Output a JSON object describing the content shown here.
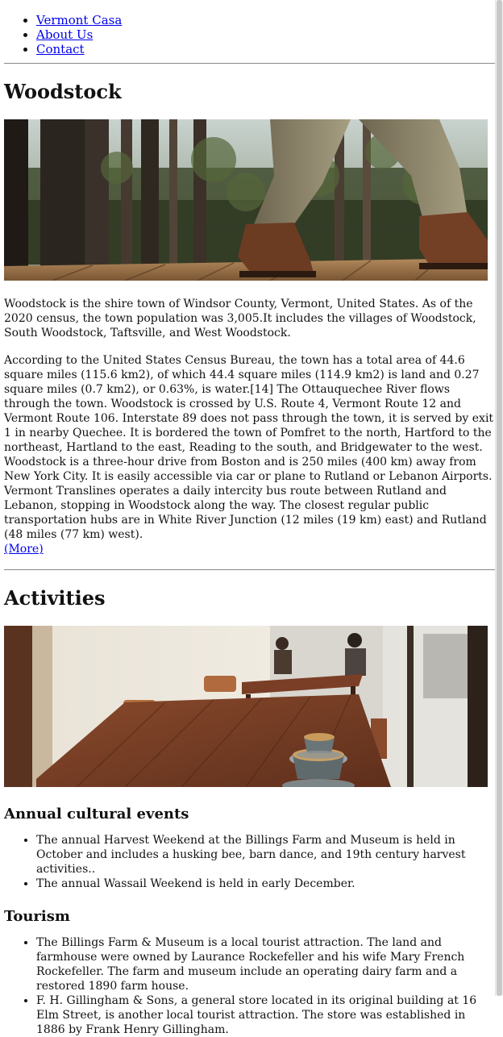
{
  "nav": {
    "items": [
      {
        "label": "Vermont Casa"
      },
      {
        "label": "About Us"
      },
      {
        "label": "Contact"
      }
    ]
  },
  "woodstock": {
    "heading": "Woodstock",
    "intro": "Woodstock is the shire town of Windsor County, Vermont, United States. As of the 2020 census, the town population was 3,005.It includes the villages of Woodstock, South Woodstock, Taftsville, and West Woodstock.",
    "geography": "According to the United States Census Bureau, the town has a total area of 44.6 square miles (115.6 km2), of which 44.4 square miles (114.9 km2) is land and 0.27 square miles (0.7 km2), or 0.63%, is water.[14] The Ottauquechee River flows through the town. Woodstock is crossed by U.S. Route 4, Vermont Route 12 and Vermont Route 106. Interstate 89 does not pass through the town, it is served by exit 1 in nearby Quechee. It is bordered the town of Pomfret to the north, Hartford to the northeast, Hartland to the east, Reading to the south, and Bridgewater to the west. Woodstock is a three-hour drive from Boston and is 250 miles (400 km) away from New York City. It is easily accessible via car or plane to Rutland or Lebanon Airports. Vermont Translines operates a daily intercity bus route between Rutland and Lebanon, stopping in Woodstock along the way. The closest regular public transportation hubs are in White River Junction (12 miles (19 km) east) and Rutland (48 miles (77 km) west).",
    "more_link": "(More)"
  },
  "activities": {
    "heading": "Activities",
    "annual": {
      "heading": "Annual cultural events",
      "items": [
        "The annual Harvest Weekend at the Billings Farm and Museum is held in October and includes a husking bee, barn dance, and 19th century harvest activities..",
        "The annual Wassail Weekend is held in early December."
      ]
    },
    "tourism": {
      "heading": "Tourism",
      "items": [
        "The Billings Farm & Museum is a local tourist attraction. The land and farmhouse were owned by Laurance Rockefeller and his wife Mary French Rockefeller. The farm and museum include an operating dairy farm and a restored 1890 farm house.",
        "F. H. Gillingham & Sons, a general store located in its original building at 16 Elm Street, is another local tourist attraction. The store was established in 1886 by Frank Henry Gillingham."
      ]
    }
  },
  "images": {
    "hero1": "forest-boardwalk-hiker-photo",
    "hero2": "cafe-wooden-table-coffee-photo"
  }
}
